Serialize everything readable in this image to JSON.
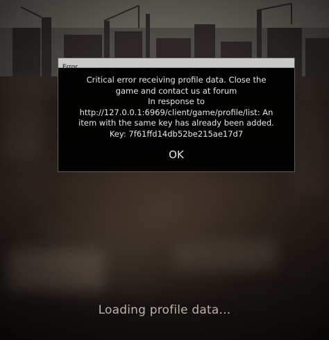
{
  "dialog": {
    "title": "Error",
    "message_lines": [
      "Critical error receiving profile data. Close the",
      "game and contact us at forum",
      "In response to",
      "http://127.0.0.1:6969/client/game/profile/list: An",
      "item with the same key has already been added.",
      "Key: 7f61ffd14db52be215ae17d7"
    ],
    "ok_label": "OK"
  },
  "status": {
    "loading_text": "Loading profile data..."
  },
  "colors": {
    "titlebar": "#c8c8c8",
    "dialog_background": "#000000",
    "dialog_text": "#e6e6e6",
    "loading_text": "#b9b3aa"
  }
}
